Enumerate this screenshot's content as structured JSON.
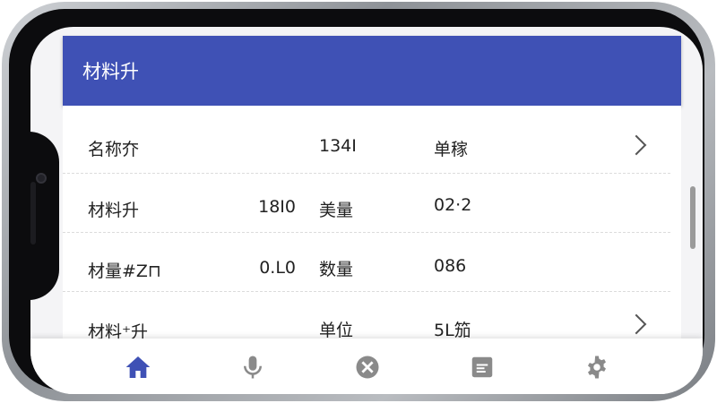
{
  "app_bar": {
    "title": "材料升"
  },
  "rows": [
    {
      "c1": "名称夰",
      "c2": "",
      "c3": "134Ⅰ",
      "c4": "单稼",
      "chevron": true
    },
    {
      "c1": "材料升",
      "c2": "18Ⅰ0",
      "c3": "美量",
      "c4": "02·2",
      "chevron": false
    },
    {
      "c1": "材量#Z⊓",
      "c2": "0.L0",
      "c3": "数量",
      "c4": "086",
      "chevron": false
    },
    {
      "c1": "材料⁺升",
      "c2": "",
      "c3": "单位",
      "c4": "5L笳",
      "chevron": true
    }
  ],
  "bottom_nav": [
    {
      "name": "home",
      "icon": "home-icon",
      "active": true
    },
    {
      "name": "mic",
      "icon": "microphone-icon",
      "active": false
    },
    {
      "name": "cancel",
      "icon": "close-circle-icon",
      "active": false
    },
    {
      "name": "notes",
      "icon": "document-icon",
      "active": false
    },
    {
      "name": "settings",
      "icon": "gear-icon",
      "active": false
    }
  ],
  "colors": {
    "primary": "#3f51b5",
    "icon_gray": "#8a8a8a"
  }
}
